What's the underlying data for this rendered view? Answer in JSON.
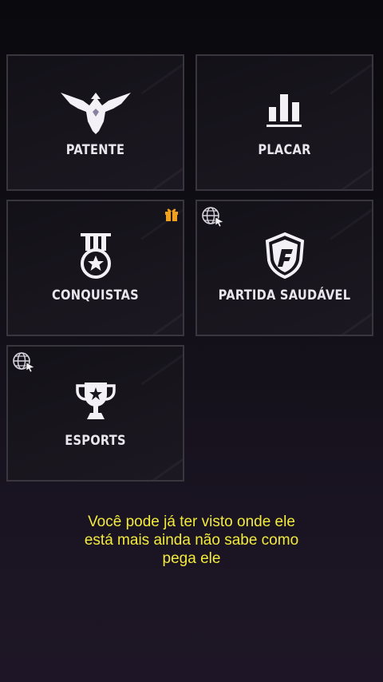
{
  "tiles": [
    {
      "label": "PATENTE",
      "icon": "eagle-icon"
    },
    {
      "label": "PLACAR",
      "icon": "leaderboard-icon"
    },
    {
      "label": "CONQUISTAS",
      "icon": "medal-icon",
      "badge": "gift-icon"
    },
    {
      "label": "PARTIDA SAUDÁVEL",
      "icon": "fair-play-shield-icon",
      "badge": "web-link-icon"
    },
    {
      "label": "ESPORTS",
      "icon": "trophy-icon",
      "badge": "web-link-icon"
    }
  ],
  "caption": {
    "line1": "Você pode já ter visto onde ele",
    "line2": "está mais ainda não sabe como",
    "line3": "pega ele"
  },
  "colors": {
    "caption": "#f2ea3c",
    "gift": "#f0a020",
    "icon": "#f1eef4"
  }
}
